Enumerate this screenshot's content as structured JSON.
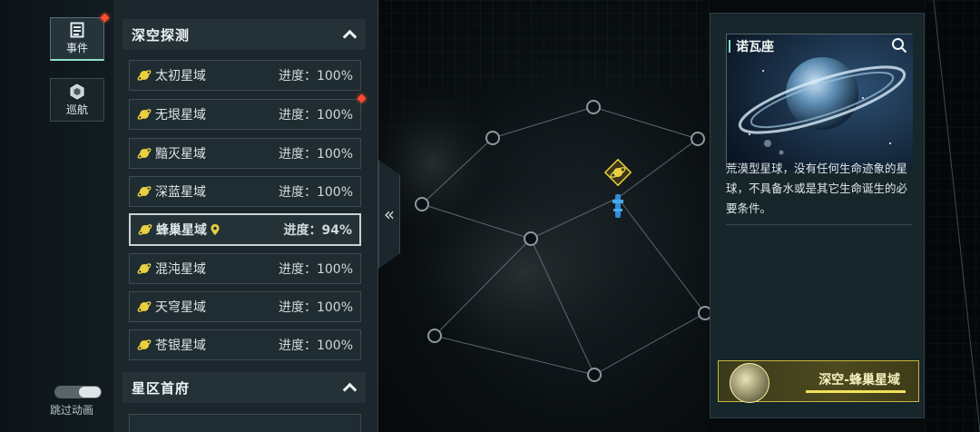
{
  "nav": {
    "events_label": "事件",
    "cruise_label": "巡航",
    "skip_animation_label": "跳过动画"
  },
  "sections": [
    {
      "title": "深空探测",
      "rows": [
        {
          "name": "太初星域",
          "progress": "进度：100%"
        },
        {
          "name": "无垠星域",
          "progress": "进度：100%"
        },
        {
          "name": "黯灭星域",
          "progress": "进度：100%"
        },
        {
          "name": "深蓝星域",
          "progress": "进度：100%"
        },
        {
          "name": "蜂巢星域",
          "progress": "进度：94%"
        },
        {
          "name": "混沌星域",
          "progress": "进度：100%"
        },
        {
          "name": "天穹星域",
          "progress": "进度：100%"
        },
        {
          "name": "苍银星域",
          "progress": "进度：100%"
        }
      ]
    },
    {
      "title": "星区首府",
      "rows": []
    }
  ],
  "card": {
    "title": "诺瓦座",
    "description": "荒漠型星球，没有任何生命迹象的星球，不具备水或是其它生命诞生的必要条件。",
    "current_location": "深空-蜂巢星域"
  },
  "colors": {
    "accent_green": "#8fe3c8",
    "planet_yellow": "#e9d040",
    "notify_red": "#ff4d2e",
    "current_gold": "#c9b640"
  },
  "icons": {
    "events": "document-icon",
    "cruise": "hexagon-icon",
    "row": "planet-icon",
    "selected_marker": "location-pin-icon",
    "collapse": "double-chevron-left-icon",
    "search": "search-icon"
  }
}
